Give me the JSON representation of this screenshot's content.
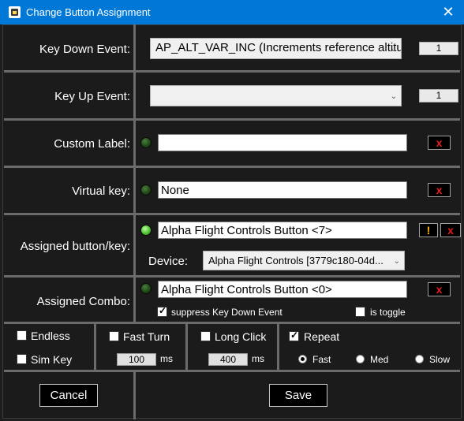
{
  "window": {
    "title": "Change Button Assignment",
    "close_glyph": "✕"
  },
  "rows": {
    "key_down": {
      "label": "Key Down Event:",
      "value": "AP_ALT_VAR_INC (Increments reference altitude)",
      "count": "1"
    },
    "key_up": {
      "label": "Key Up Event:",
      "value": "",
      "count": "1"
    },
    "custom_label": {
      "label": "Custom Label:",
      "value": "",
      "clear": "x"
    },
    "virtual_key": {
      "label": "Virtual key:",
      "value": "None",
      "clear": "x"
    },
    "assigned": {
      "label": "Assigned button/key:",
      "value": "Alpha Flight Controls Button <7>",
      "warn": "!",
      "clear": "x",
      "device_label": "Device:",
      "device_value": "Alpha Flight Controls [3779c180-04d..."
    },
    "combo": {
      "label": "Assigned Combo:",
      "value": "Alpha Flight Controls Button <0>",
      "clear": "x",
      "suppress_label": "suppress Key Down Event",
      "suppress_checked": true,
      "toggle_label": "is toggle",
      "toggle_checked": false
    }
  },
  "options": {
    "endless": {
      "label": "Endless",
      "checked": false
    },
    "sim_key": {
      "label": "Sim Key",
      "checked": false
    },
    "fast_turn": {
      "label": "Fast Turn",
      "checked": false,
      "value": "100",
      "unit": "ms"
    },
    "long_click": {
      "label": "Long Click",
      "checked": false,
      "value": "400",
      "unit": "ms"
    },
    "repeat": {
      "label": "Repeat",
      "checked": true
    },
    "speed": {
      "options": [
        "Fast",
        "Med",
        "Slow"
      ],
      "selected": "Fast"
    }
  },
  "buttons": {
    "cancel": "Cancel",
    "save": "Save"
  }
}
